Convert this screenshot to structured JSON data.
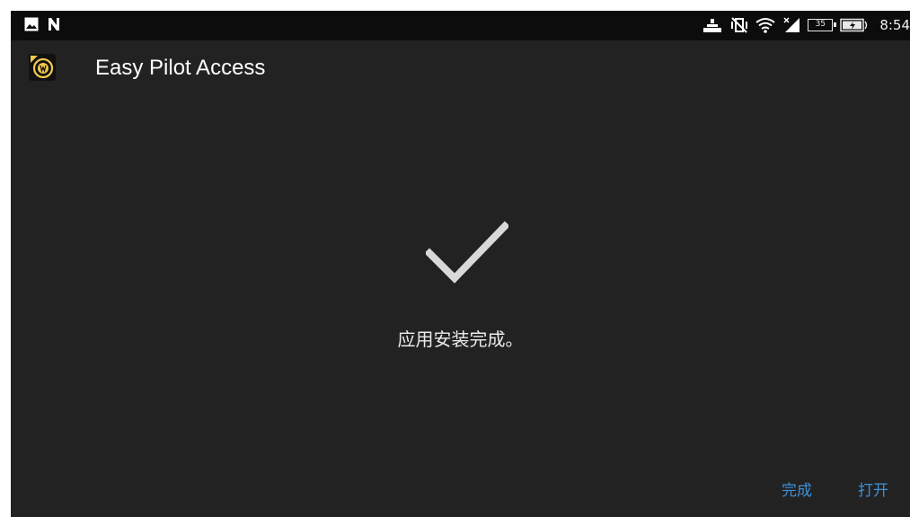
{
  "status_bar": {
    "left_icons": [
      "image-icon",
      "nfc-n-icon"
    ],
    "right_icons": [
      "download-tray-icon",
      "vibrate-off-icon",
      "wifi-icon",
      "signal-icon",
      "battery-icon",
      "battery-charging-icon"
    ],
    "battery_level": "35",
    "time": "8:54"
  },
  "header": {
    "app_icon": "app-logo-icon",
    "title": "Easy Pilot Access"
  },
  "main": {
    "status_icon": "checkmark-icon",
    "message": "应用安装完成。"
  },
  "actions": {
    "done_label": "完成",
    "open_label": "打开"
  },
  "colors": {
    "background": "#222222",
    "status_bar": "#0c0c0c",
    "accent": "#3d8fd8",
    "check": "#d9d9d9"
  }
}
